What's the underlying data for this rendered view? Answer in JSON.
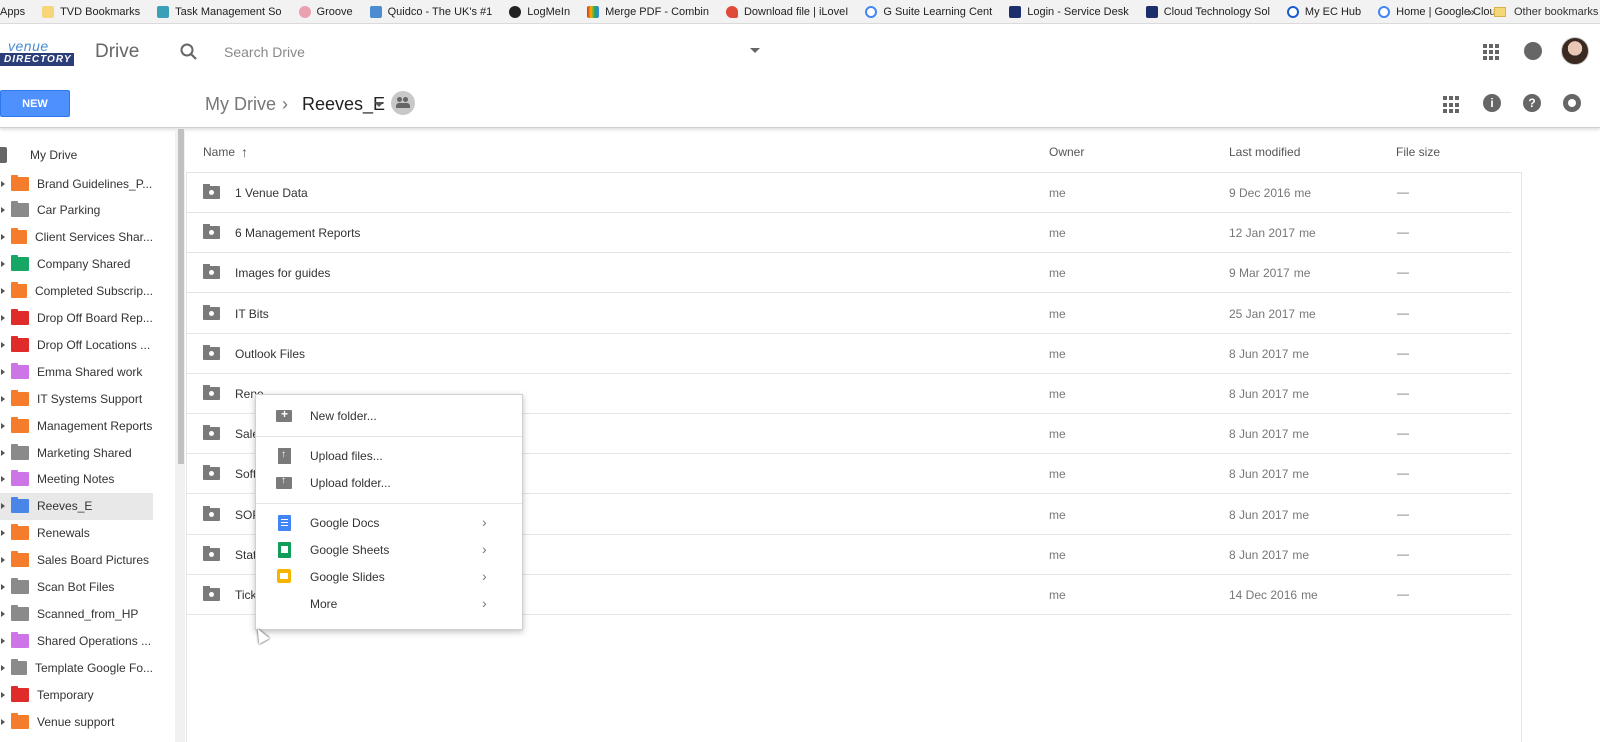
{
  "bookmarks": [
    {
      "label": "Apps",
      "color": "#4285f4"
    },
    {
      "label": "TVD Bookmarks",
      "color": "#f5d77a"
    },
    {
      "label": "Task Management So",
      "color": "#3aa0b8"
    },
    {
      "label": "Groove",
      "color": "#e9a0b0"
    },
    {
      "label": "Quidco - The UK's #1",
      "color": "#4a8bd1"
    },
    {
      "label": "LogMeIn",
      "color": "#222222"
    },
    {
      "label": "Merge PDF - Combin",
      "color": "#d94b8a"
    },
    {
      "label": "Download file | iLoveI",
      "color": "#e04a3a"
    },
    {
      "label": "G Suite Learning Cent",
      "color": "#4285f4"
    },
    {
      "label": "Login - Service Desk",
      "color": "#1a2f6b"
    },
    {
      "label": "Cloud Technology Sol",
      "color": "#1a2f6b"
    },
    {
      "label": "My EC Hub",
      "color": "#1a5bd1"
    },
    {
      "label": "Home | Google Cloud",
      "color": "#4285f4"
    }
  ],
  "bookmarks_more": "»",
  "other_bookmarks": "Other bookmarks",
  "header": {
    "logo_top": "venue",
    "logo_bottom": "DIRECTORY",
    "product": "Drive",
    "search_placeholder": "Search Drive"
  },
  "toolbar": {
    "new_label": "NEW",
    "breadcrumb_root": "My Drive",
    "breadcrumb_sep": "›",
    "breadcrumb_current": "Reeves_E"
  },
  "sidebar": {
    "root": "My Drive",
    "items": [
      {
        "label": "Brand Guidelines_P...",
        "color": "#f57c2b"
      },
      {
        "label": "Car Parking",
        "color": "#8a8a8a"
      },
      {
        "label": "Client Services Shar...",
        "color": "#f57c2b"
      },
      {
        "label": "Company Shared",
        "color": "#16a765"
      },
      {
        "label": "Completed Subscrip...",
        "color": "#f57c2b"
      },
      {
        "label": "Drop Off Board Rep...",
        "color": "#e02b2b"
      },
      {
        "label": "Drop Off Locations ...",
        "color": "#e02b2b"
      },
      {
        "label": "Emma Shared work",
        "color": "#cd74e6"
      },
      {
        "label": "IT Systems Support",
        "color": "#f57c2b"
      },
      {
        "label": "Management Reports",
        "color": "#f57c2b"
      },
      {
        "label": "Marketing Shared",
        "color": "#8a8a8a"
      },
      {
        "label": "Meeting Notes",
        "color": "#cd74e6"
      },
      {
        "label": "Reeves_E",
        "color": "#4a86e8"
      },
      {
        "label": "Renewals",
        "color": "#f57c2b"
      },
      {
        "label": "Sales Board Pictures",
        "color": "#f57c2b"
      },
      {
        "label": "Scan Bot Files",
        "color": "#8a8a8a"
      },
      {
        "label": "Scanned_from_HP",
        "color": "#8a8a8a"
      },
      {
        "label": "Shared Operations ...",
        "color": "#cd74e6"
      },
      {
        "label": "Template Google Fo...",
        "color": "#8a8a8a"
      },
      {
        "label": "Temporary",
        "color": "#e02b2b"
      },
      {
        "label": "Venue support",
        "color": "#f57c2b"
      }
    ]
  },
  "columns": {
    "name": "Name",
    "sort": "↑",
    "owner": "Owner",
    "modified": "Last modified",
    "size": "File size"
  },
  "files": [
    {
      "name": "1 Venue Data",
      "owner": "me",
      "date": "9 Dec 2016",
      "by": "me",
      "size": "—"
    },
    {
      "name": "6 Management Reports",
      "owner": "me",
      "date": "12 Jan 2017",
      "by": "me",
      "size": "—"
    },
    {
      "name": "Images for guides",
      "owner": "me",
      "date": "9 Mar 2017",
      "by": "me",
      "size": "—"
    },
    {
      "name": "IT Bits",
      "owner": "me",
      "date": "25 Jan 2017",
      "by": "me",
      "size": "—"
    },
    {
      "name": "Outlook Files",
      "owner": "me",
      "date": "8 Jun 2017",
      "by": "me",
      "size": "—"
    },
    {
      "name": "Rene",
      "owner": "me",
      "date": "8 Jun 2017",
      "by": "me",
      "size": "—"
    },
    {
      "name": "Sale",
      "owner": "me",
      "date": "8 Jun 2017",
      "by": "me",
      "size": "—"
    },
    {
      "name": "Softw",
      "owner": "me",
      "date": "8 Jun 2017",
      "by": "me",
      "size": "—"
    },
    {
      "name": "SOP",
      "owner": "me",
      "date": "8 Jun 2017",
      "by": "me",
      "size": "—"
    },
    {
      "name": "Stats",
      "owner": "me",
      "date": "8 Jun 2017",
      "by": "me",
      "size": "—"
    },
    {
      "name": "Tick",
      "owner": "me",
      "date": "14 Dec 2016",
      "by": "me",
      "size": "—"
    }
  ],
  "context_menu": {
    "new_folder": "New folder...",
    "upload_files": "Upload files...",
    "upload_folder": "Upload folder...",
    "docs": "Google Docs",
    "sheets": "Google Sheets",
    "slides": "Google Slides",
    "more": "More",
    "chevron": "›"
  }
}
